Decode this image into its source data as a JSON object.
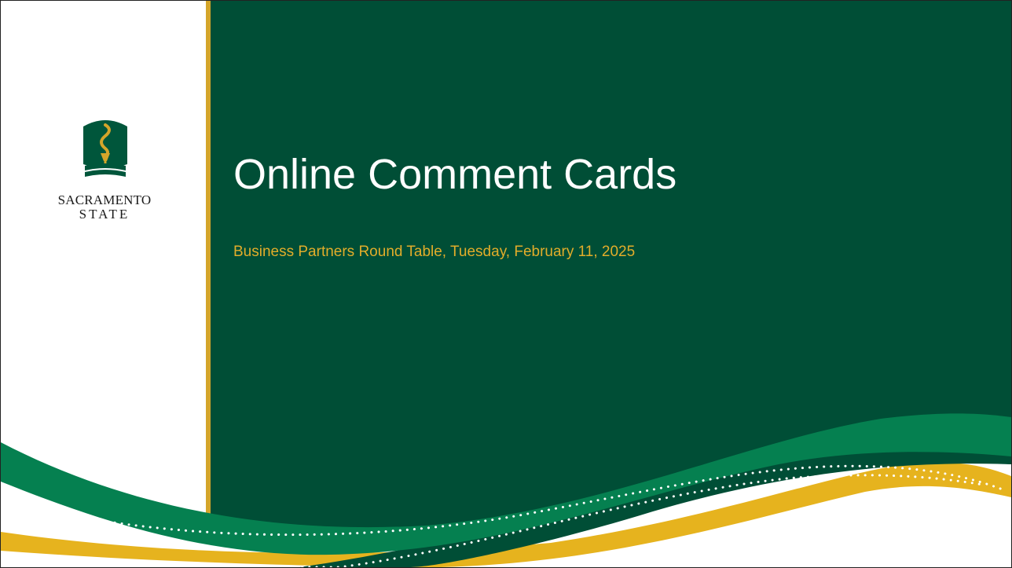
{
  "slide": {
    "title": "Online Comment Cards",
    "subtitle": "Business Partners Round Table, Tuesday, February 11, 2025"
  },
  "logo": {
    "line1": "SACRAMENTO",
    "line2": "STATE"
  },
  "colors": {
    "dark_green": "#004e36",
    "mid_green": "#058050",
    "gold": "#e2ad2a",
    "white": "#ffffff"
  }
}
